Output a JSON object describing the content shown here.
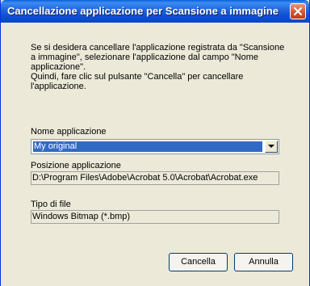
{
  "window": {
    "title": "Cancellazione applicazione per Scansione a immagine"
  },
  "message": {
    "line1": "Se si desidera cancellare l'applicazione registrata da \"Scansione",
    "line2": "a immagine\", selezionare l'applicazione dal campo \"Nome",
    "line3": "applicazione\".",
    "line4": "Quindi, fare clic sul pulsante \"Cancella\" per cancellare",
    "line5": "l'applicazione."
  },
  "app_name": {
    "label": "Nome applicazione",
    "selected": "My original"
  },
  "app_location": {
    "label": "Posizione applicazione",
    "value": "D:\\Program Files\\Adobe\\Acrobat 5.0\\Acrobat\\Acrobat.exe"
  },
  "file_type": {
    "label": "Tipo di file",
    "value": "Windows Bitmap (*.bmp)"
  },
  "buttons": {
    "delete": "Cancella",
    "cancel": "Annulla"
  }
}
